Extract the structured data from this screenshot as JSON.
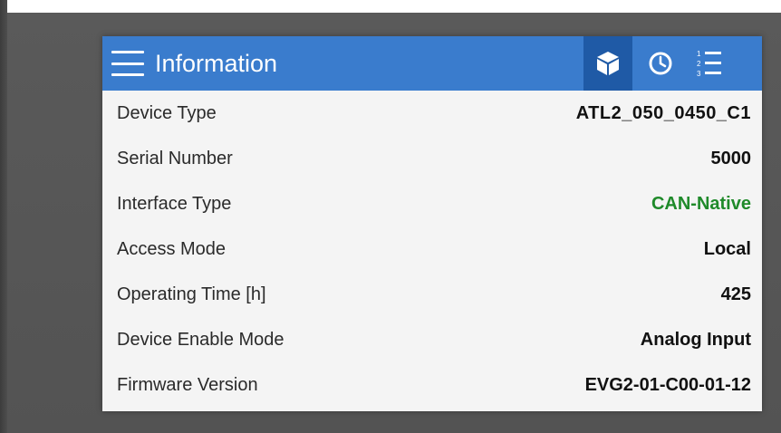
{
  "header": {
    "title": "Information",
    "background_color": "#3a7ccd",
    "active_tab_color": "#1f5aa6",
    "tabs": [
      {
        "icon": "cube-icon",
        "active": true
      },
      {
        "icon": "clock-icon",
        "active": false
      },
      {
        "icon": "numbered-list-icon",
        "active": false
      }
    ]
  },
  "info_rows": [
    {
      "label": "Device Type",
      "value": "ATL2_050_0450_C1"
    },
    {
      "label": "Serial Number",
      "value": "5000"
    },
    {
      "label": "Interface Type",
      "value": "CAN-Native",
      "value_color": "#1f8a2a"
    },
    {
      "label": "Access Mode",
      "value": "Local"
    },
    {
      "label": "Operating Time [h]",
      "value": "425"
    },
    {
      "label": "Device Enable Mode",
      "value": "Analog Input"
    },
    {
      "label": "Firmware Version",
      "value": "EVG2-01-C00-01-12"
    }
  ]
}
